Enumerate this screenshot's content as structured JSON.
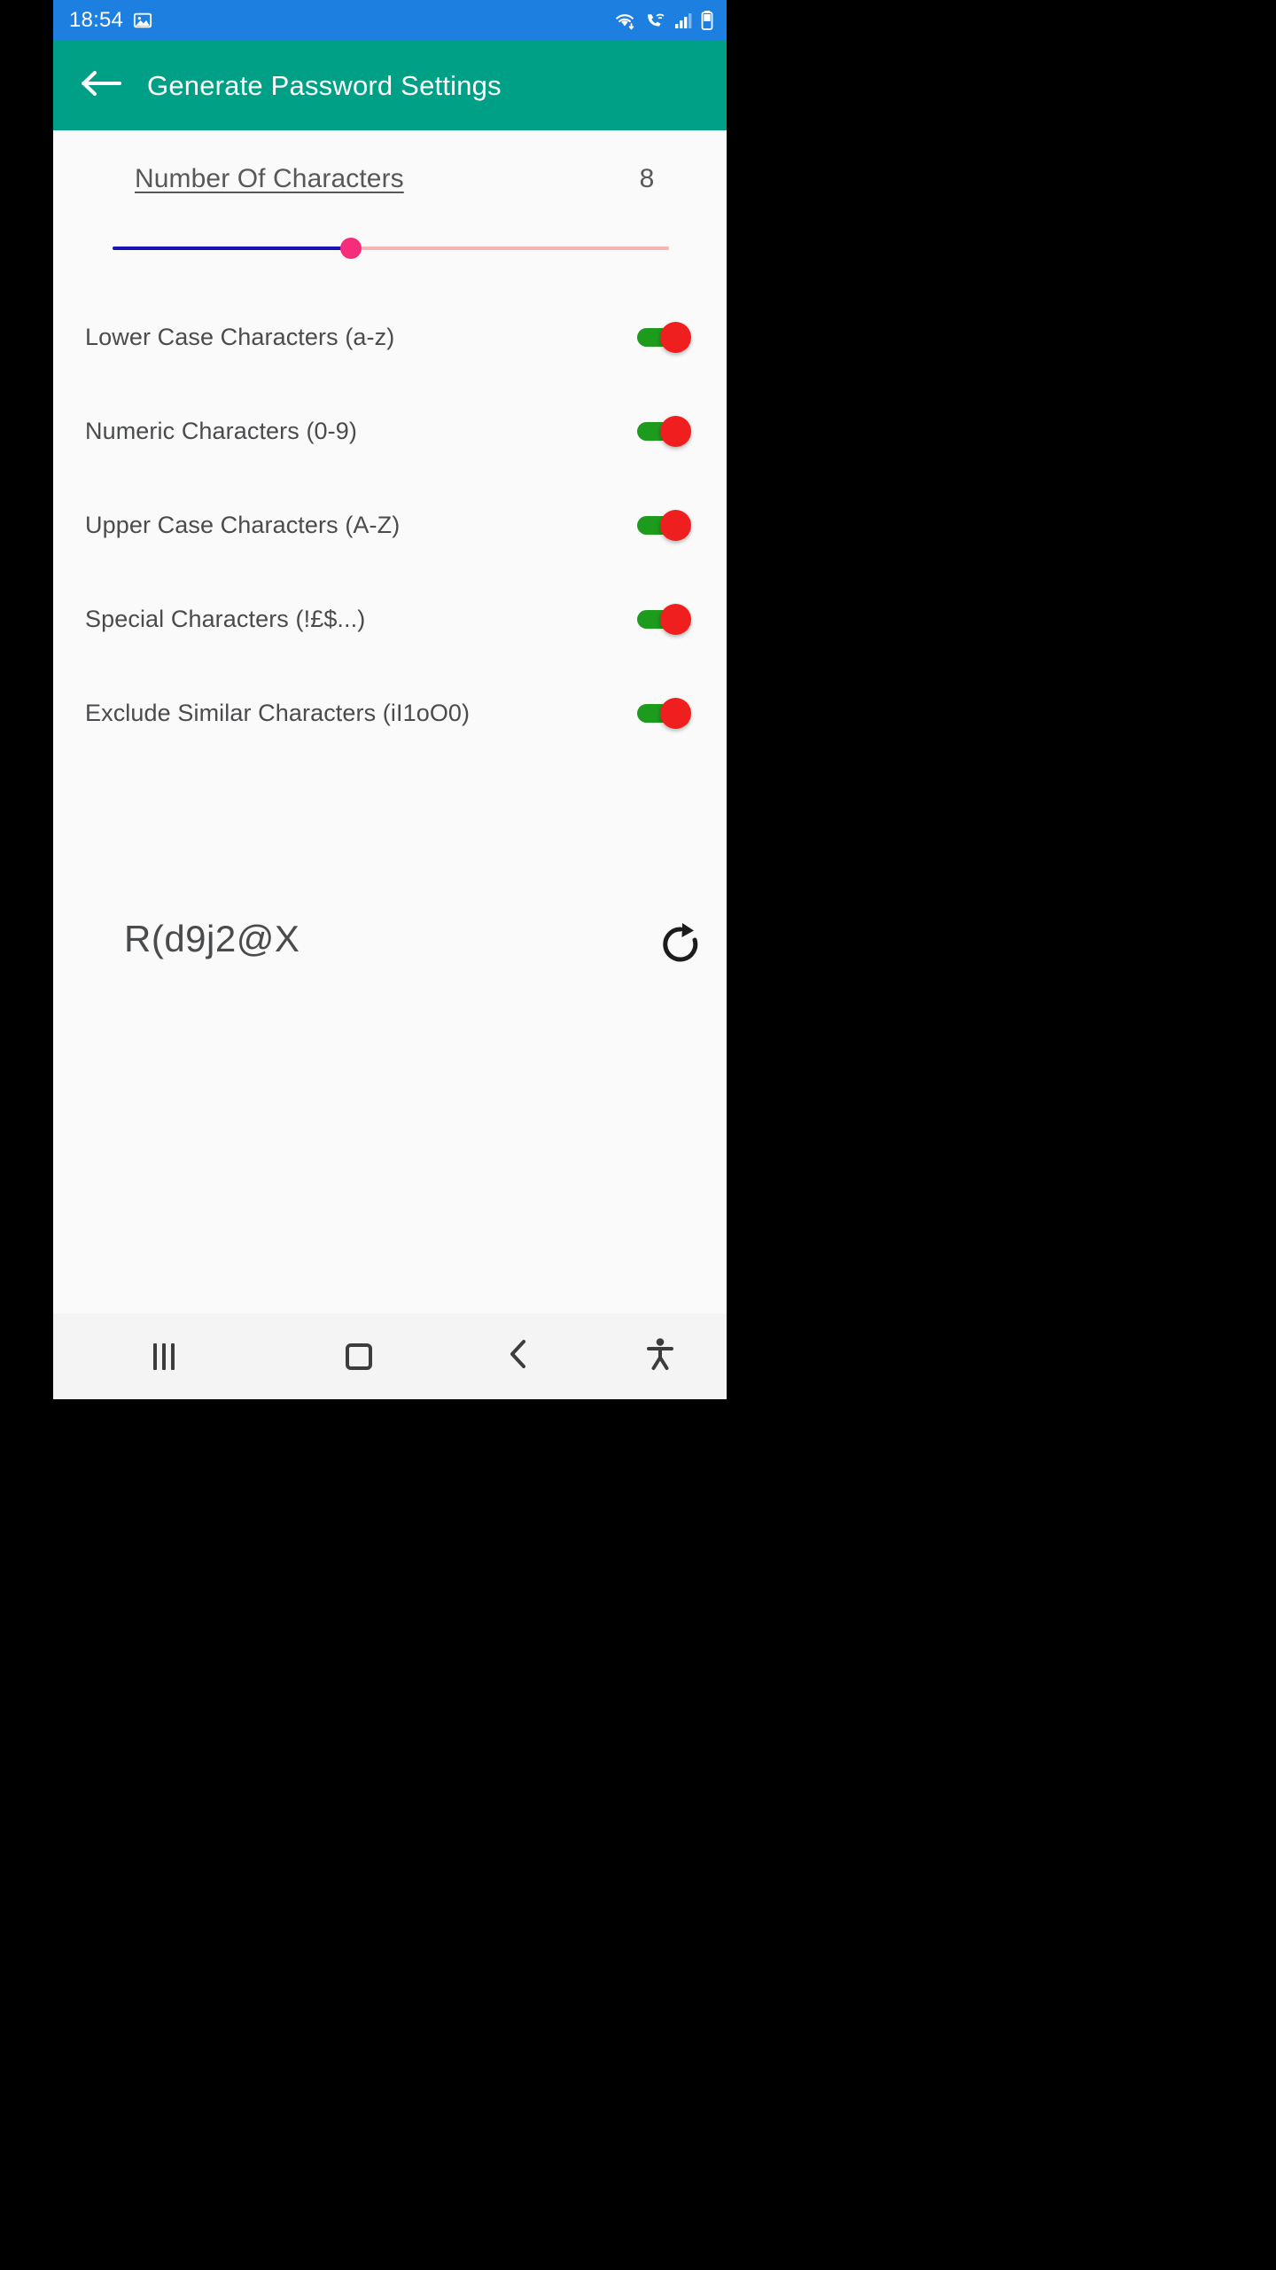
{
  "status_bar": {
    "time": "18:54",
    "left_icons": [
      "image-icon"
    ],
    "right_icons": [
      "wifi-icon",
      "wifi-calling-icon",
      "signal-icon",
      "battery-icon"
    ],
    "background_color": "#1d7fe0"
  },
  "app_bar": {
    "title": "Generate Password Settings",
    "back_icon": "arrow-left-icon",
    "background_color": "#00a087",
    "text_color": "#ffffff"
  },
  "settings": {
    "char_count": {
      "label": "Number Of Characters",
      "value": "8"
    },
    "slider": {
      "value": 8,
      "min": 1,
      "max": 20,
      "fill_percent": 43,
      "active_color": "#1a14b4",
      "inactive_color": "#f5b5b5",
      "thumb_color": "#f52d7a"
    },
    "options": [
      {
        "label": "Lower Case Characters (a-z)",
        "enabled": true
      },
      {
        "label": "Numeric Characters (0-9)",
        "enabled": true
      },
      {
        "label": "Upper Case Characters (A-Z)",
        "enabled": true
      },
      {
        "label": "Special Characters (!£$...)",
        "enabled": true
      },
      {
        "label": "Exclude Similar Characters (iI1oO0)",
        "enabled": true
      }
    ],
    "switch_colors": {
      "track_on": "#1d9b1d",
      "thumb_on": "#ef1f1f"
    }
  },
  "result": {
    "password": "R(d9j2@X",
    "refresh_icon": "refresh-icon"
  },
  "nav_bar": {
    "recents_icon": "recents-icon",
    "home_icon": "home-icon",
    "back_icon": "chevron-left-icon",
    "accessibility_icon": "accessibility-icon",
    "background_color": "#f4f4f4"
  }
}
